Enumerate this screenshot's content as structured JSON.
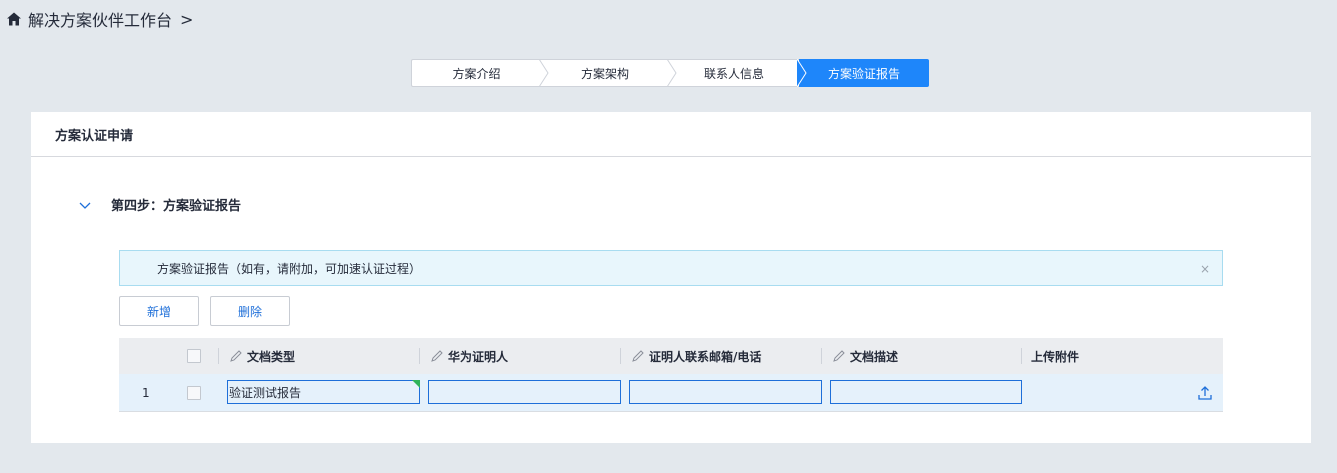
{
  "breadcrumb": {
    "home_icon": "home-icon",
    "title": "解决方案伙伴工作台",
    "chevron": ">"
  },
  "steps": [
    {
      "label": "方案介绍",
      "active": false
    },
    {
      "label": "方案架构",
      "active": false
    },
    {
      "label": "联系人信息",
      "active": false
    },
    {
      "label": "方案验证报告",
      "active": true
    }
  ],
  "panel": {
    "title": "方案认证申请",
    "section_title": "第四步：方案验证报告",
    "alert_text": "方案验证报告（如有，请附加，可加速认证过程）",
    "alert_close": "×",
    "add_button": "新增",
    "delete_button": "删除"
  },
  "table": {
    "columns": [
      "文档类型",
      "华为证明人",
      "证明人联系邮箱/电话",
      "文档描述",
      "上传附件"
    ],
    "rows": [
      {
        "index": "1",
        "doc_type": "验证测试报告",
        "witness": "",
        "contact": "",
        "description": ""
      }
    ]
  },
  "colors": {
    "accent": "#1e86fa",
    "link": "#1e6fd9",
    "page_bg": "#e3e8ed",
    "row_selected": "#e5f1fb",
    "alert_bg": "#e8f6fc"
  }
}
